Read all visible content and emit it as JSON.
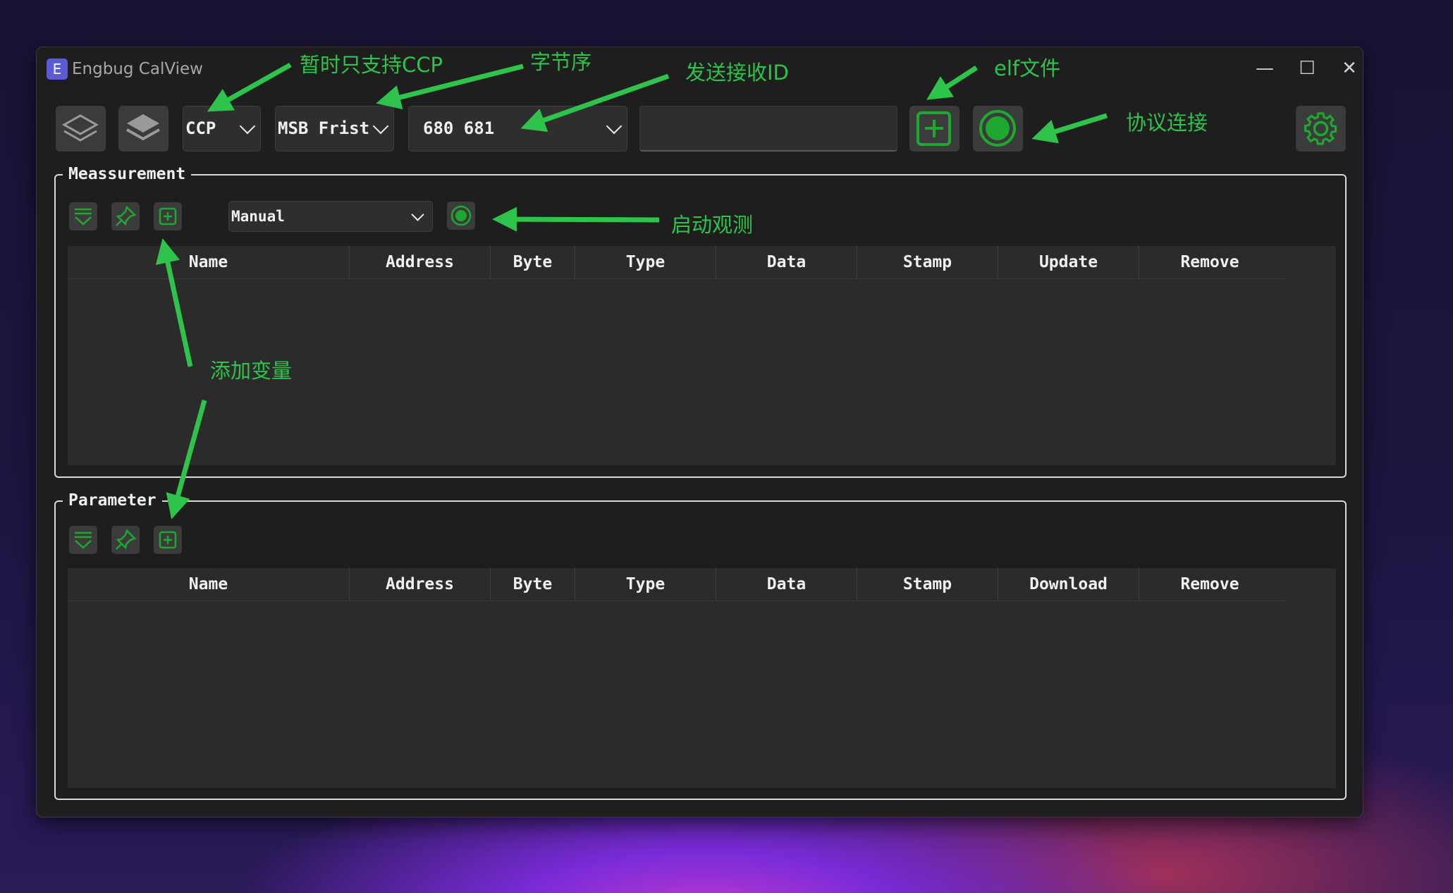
{
  "window": {
    "title": "Engbug CalView",
    "app_icon_letter": "E"
  },
  "titlebar": {
    "minimize": "—",
    "maximize": "☐",
    "close": "✕"
  },
  "toolbar": {
    "protocol": "CCP",
    "byte_order": "MSB Frist",
    "ids": "680 681",
    "elf_path": ""
  },
  "measurement": {
    "title": "Meassurement",
    "mode": "Manual",
    "columns": [
      "Name",
      "Address",
      "Byte",
      "Type",
      "Data",
      "Stamp",
      "Update",
      "Remove"
    ],
    "rows": []
  },
  "parameter": {
    "title": "Parameter",
    "columns": [
      "Name",
      "Address",
      "Byte",
      "Type",
      "Data",
      "Stamp",
      "Download",
      "Remove"
    ],
    "rows": []
  },
  "annotations": {
    "ccp_only": "暂时只支持CCP",
    "byte_order": "字节序",
    "send_recv_id": "发送接收ID",
    "elf_file": "elf文件",
    "protocol_connect": "协议连接",
    "start_observe": "启动观测",
    "add_variable": "添加变量"
  },
  "colors": {
    "accent_green": "#2ec34a",
    "icon_green": "#1e9a2e",
    "window_bg": "#1e1e1e"
  },
  "icons": [
    "layers-outline-icon",
    "layers-filled-icon",
    "add-file-icon",
    "connect-icon",
    "gear-icon",
    "filter-icon",
    "pin-icon",
    "add-icon",
    "record-icon"
  ]
}
